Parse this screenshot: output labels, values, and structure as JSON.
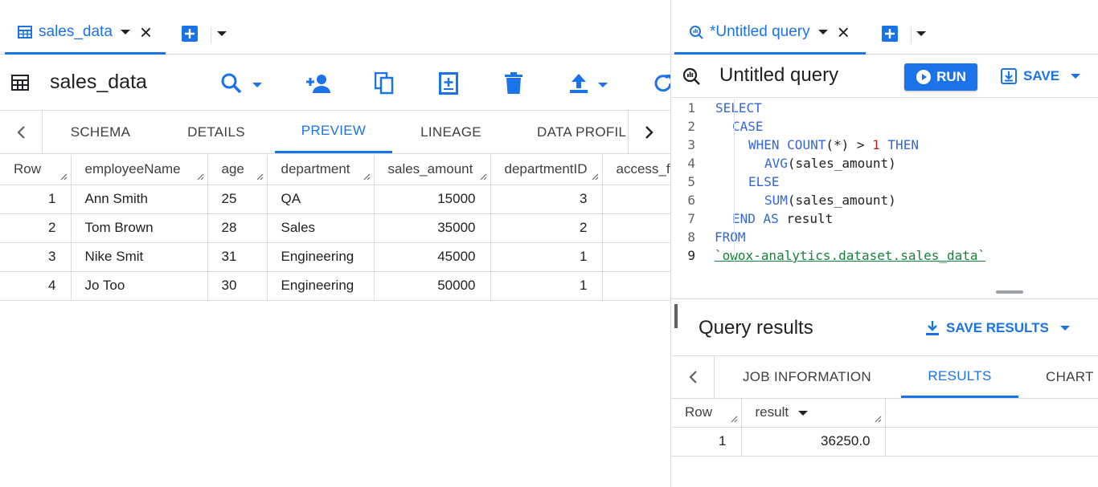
{
  "left": {
    "tab": {
      "label": "sales_data"
    },
    "title": "sales_data",
    "subtabs": [
      "SCHEMA",
      "DETAILS",
      "PREVIEW",
      "LINEAGE",
      "DATA PROFIL"
    ],
    "columns": [
      "Row",
      "employeeName",
      "age",
      "department",
      "sales_amount",
      "departmentID",
      "access_f"
    ],
    "rows": [
      [
        "1",
        "Ann Smith",
        "25",
        "QA",
        "15000",
        "3",
        ""
      ],
      [
        "2",
        "Tom Brown",
        "28",
        "Sales",
        "35000",
        "2",
        ""
      ],
      [
        "3",
        "Nike Smit",
        "31",
        "Engineering",
        "45000",
        "1",
        ""
      ],
      [
        "4",
        "Jo Too",
        "30",
        "Engineering",
        "50000",
        "1",
        ""
      ]
    ]
  },
  "right": {
    "tab": {
      "label": "*Untitled query"
    },
    "title": "Untitled query",
    "run_label": "RUN",
    "save_label": "SAVE",
    "code": {
      "line_numbers": [
        "1",
        "2",
        "3",
        "4",
        "5",
        "6",
        "7",
        "8",
        "9"
      ],
      "l1": "SELECT",
      "l2": "CASE",
      "l3_kw1": "WHEN",
      "l3_fn": "COUNT",
      "l3_mid": "(*) > ",
      "l3_num": "1",
      "l3_kw2": "THEN",
      "l4_fn": "AVG",
      "l4_arg": "(sales_amount)",
      "l5": "ELSE",
      "l6_fn": "SUM",
      "l6_arg": "(sales_amount)",
      "l7_kw1": "END",
      "l7_kw2": "AS",
      "l7_plain": "result",
      "l8": "FROM",
      "l9": "`owox-analytics.dataset.sales_data`"
    },
    "results": {
      "title": "Query results",
      "save_results_label": "SAVE RESULTS",
      "tabs": [
        "JOB INFORMATION",
        "RESULTS",
        "CHART"
      ],
      "columns": [
        "Row",
        "result"
      ],
      "rows": [
        [
          "1",
          "36250.0"
        ]
      ]
    }
  },
  "colors": {
    "accent": "#1a73e8",
    "border": "#dadce0"
  }
}
